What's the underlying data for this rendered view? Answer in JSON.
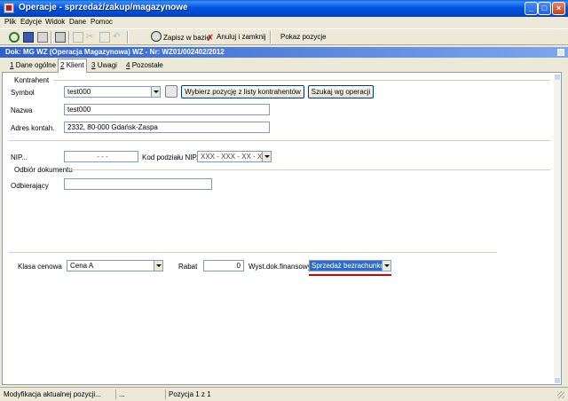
{
  "window": {
    "title": "Operacje - sprzedaż/zakup/magazynowe"
  },
  "menu": [
    "Plik",
    "Edycje",
    "Widok",
    "Dane",
    "Pomoc"
  ],
  "toolbar": {
    "save_label": "Zapisz w bazie",
    "cancel_close_label": "Anuluj i zamknij",
    "show_items_label": "Pokaz pozycje"
  },
  "doc_header": "Dok: MG WZ (Operacja Magazynowa)  WZ  -  Nr: WZ01/002402/2012",
  "tabs": [
    {
      "key": "1",
      "label": "Dane ogólne"
    },
    {
      "key": "2",
      "label": "Klient"
    },
    {
      "key": "3",
      "label": "Uwagi"
    },
    {
      "key": "4",
      "label": "Pozostałe"
    }
  ],
  "kontrahent": {
    "group_label": "Kontrahent",
    "symbol_label": "Symbol",
    "symbol_value": "test000",
    "choose_button": "Wybierz pozycję z listy kontrahentów",
    "search_button": "Szukaj wg operacji",
    "name_label": "Nazwa",
    "name_value": "test000",
    "address_label": "Adres kontah.",
    "address_value": "2332, 80-000 Gdańsk-Zaspa"
  },
  "nip": {
    "label": "NIP...",
    "value": "- - -",
    "division_label": "Kod podziału NIP...",
    "division_value": "XXX - XXX - XX - XX"
  },
  "receipt": {
    "group_label": "Odbiór dokumentu",
    "receiver_label": "Odbierający",
    "receiver_value": ""
  },
  "pricing": {
    "price_class_label": "Klasa cenowa",
    "price_class_value": "Cena A",
    "discount_label": "Rabat",
    "discount_value": "0",
    "fin_doc_label": "Wyst.dok.finansowy:",
    "fin_doc_value": "Sprzedaż bezrachunkowa"
  },
  "status": {
    "message": "Modyfikacja aktualnej pozycji...",
    "mid": "...",
    "position": "Pozycja 1 z 1"
  },
  "colors": {
    "selection": "#316ac5",
    "underline": "#cc0000",
    "titlebar": "#0054e3"
  }
}
